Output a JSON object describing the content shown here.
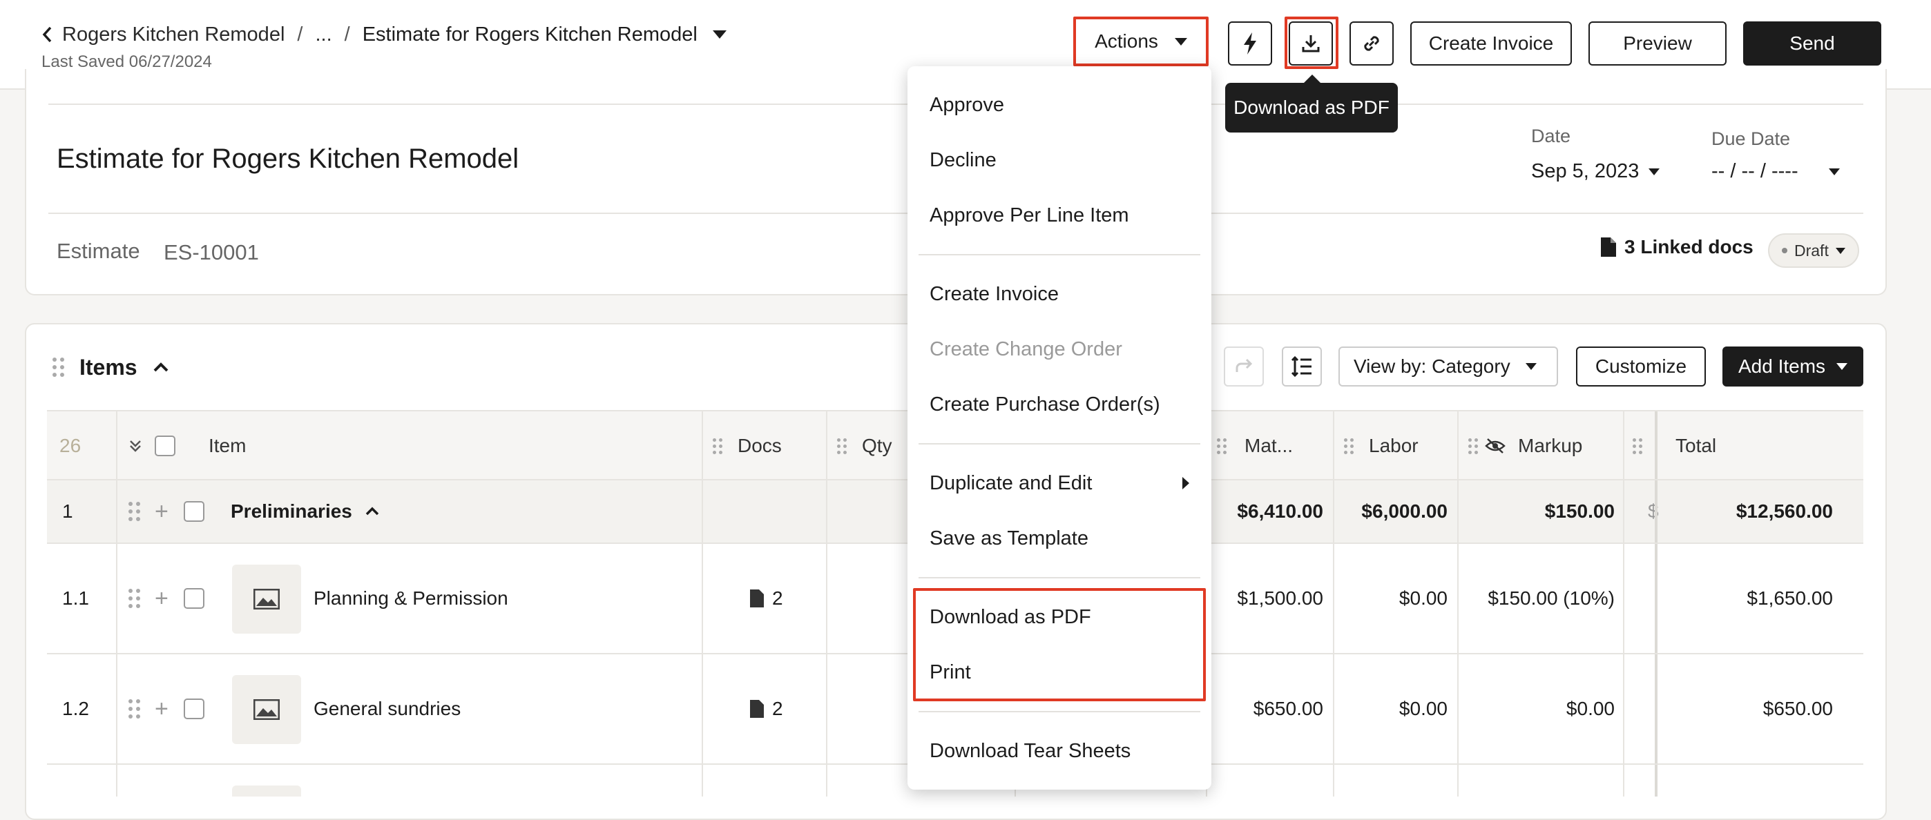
{
  "header": {
    "breadcrumb": [
      "Rogers Kitchen Remodel",
      "...",
      "Estimate for Rogers Kitchen Remodel"
    ],
    "last_saved": "Last Saved 06/27/2024",
    "actions_label": "Actions",
    "create_invoice_label": "Create Invoice",
    "preview_label": "Preview",
    "send_label": "Send",
    "tooltip": "Download as PDF"
  },
  "estimate": {
    "title": "Estimate for Rogers Kitchen Remodel",
    "label": "Estimate",
    "number": "ES-10001",
    "date_label": "Date",
    "date_value": "Sep 5, 2023",
    "due_label": "Due Date",
    "due_value": "-- / -- / ----",
    "linked_docs": "3 Linked docs",
    "status": "Draft"
  },
  "items": {
    "title": "Items",
    "view_by": "View by: Category",
    "customize": "Customize",
    "add_items": "Add Items",
    "count": "26",
    "columns": {
      "item": "Item",
      "docs": "Docs",
      "qty": "Qty",
      "mat": "Mat...",
      "labor": "Labor",
      "markup": "Markup",
      "total": "Total"
    },
    "group": {
      "num": "1",
      "name": "Preliminaries",
      "mat": "$6,410.00",
      "labor": "$6,000.00",
      "markup": "$150.00",
      "partial": "$",
      "total": "$12,560.00"
    },
    "rows": [
      {
        "num": "1.1",
        "name": "Planning & Permission",
        "docs": "2",
        "mat": "$1,500.00",
        "labor": "$0.00",
        "markup": "$150.00 (10%)",
        "total": "$1,650.00"
      },
      {
        "num": "1.2",
        "name": "General sundries",
        "docs": "2",
        "mat": "$650.00",
        "labor": "$0.00",
        "markup": "$0.00",
        "total": "$650.00"
      }
    ]
  },
  "menu": {
    "approve": "Approve",
    "decline": "Decline",
    "approve_per_line": "Approve Per Line Item",
    "create_invoice": "Create Invoice",
    "create_change_order": "Create Change Order",
    "create_po": "Create Purchase Order(s)",
    "duplicate_edit": "Duplicate and Edit",
    "save_template": "Save as Template",
    "download_pdf": "Download as PDF",
    "print": "Print",
    "tear_sheets": "Download Tear Sheets"
  }
}
